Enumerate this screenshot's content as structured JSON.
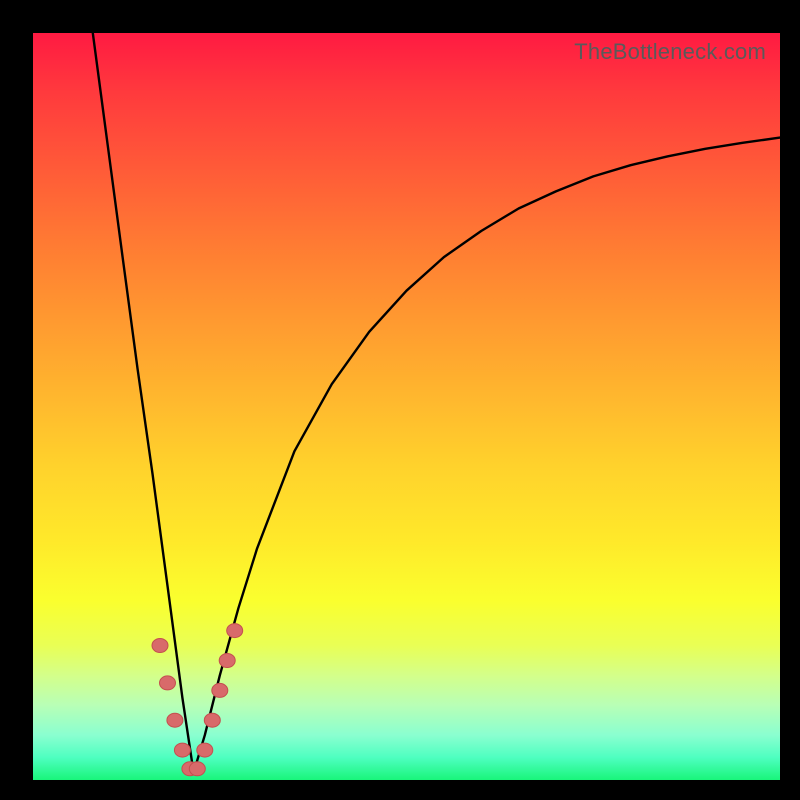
{
  "watermark": "TheBottleneck.com",
  "colors": {
    "frame_bg": "#000000",
    "bead_fill": "#d86a6a",
    "bead_stroke": "#c44f4f",
    "curve_stroke": "#000000"
  },
  "chart_data": {
    "type": "line",
    "title": "",
    "xlabel": "",
    "ylabel": "",
    "xlim": [
      0,
      100
    ],
    "ylim": [
      0,
      100
    ],
    "grid": false,
    "legend": false,
    "annotations": [],
    "description": "V-shaped bottleneck curve: mismatch percentage vs component balance (unlabeled axes). Minimum near x≈21.5.",
    "series": [
      {
        "name": "bottleneck_curve",
        "x": [
          8.0,
          10.0,
          12.0,
          14.0,
          16.0,
          18.0,
          20.0,
          21.5,
          23.0,
          25.0,
          27.5,
          30.0,
          35.0,
          40.0,
          45.0,
          50.0,
          55.0,
          60.0,
          65.0,
          70.0,
          75.0,
          80.0,
          85.0,
          90.0,
          95.0,
          100.0
        ],
        "y": [
          100.0,
          85.0,
          70.0,
          55.0,
          41.0,
          26.0,
          11.0,
          1.0,
          6.0,
          14.0,
          23.0,
          31.0,
          44.0,
          53.0,
          60.0,
          65.5,
          70.0,
          73.5,
          76.5,
          78.8,
          80.8,
          82.3,
          83.5,
          84.5,
          85.3,
          86.0
        ]
      }
    ],
    "highlighted_points": [
      {
        "x": 17.0,
        "y": 18.0
      },
      {
        "x": 18.0,
        "y": 13.0
      },
      {
        "x": 19.0,
        "y": 8.0
      },
      {
        "x": 20.0,
        "y": 4.0
      },
      {
        "x": 21.0,
        "y": 1.5
      },
      {
        "x": 22.0,
        "y": 1.5
      },
      {
        "x": 23.0,
        "y": 4.0
      },
      {
        "x": 24.0,
        "y": 8.0
      },
      {
        "x": 25.0,
        "y": 12.0
      },
      {
        "x": 26.0,
        "y": 16.0
      },
      {
        "x": 27.0,
        "y": 20.0
      }
    ]
  }
}
